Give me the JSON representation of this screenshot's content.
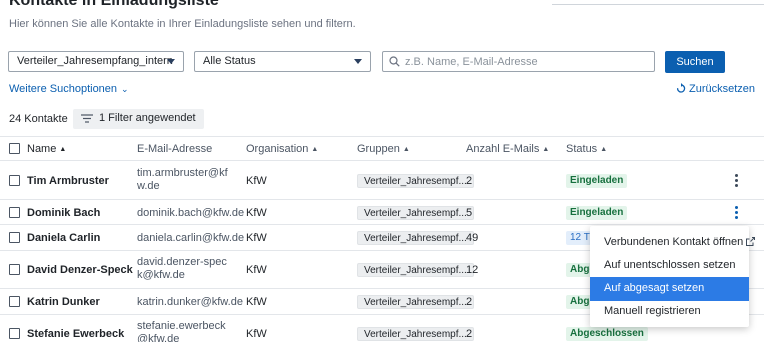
{
  "page": {
    "title": "Kontakte in Einladungsliste",
    "subtitle": "Hier können Sie alle Kontakte in Ihrer Einladungsliste sehen und filtern."
  },
  "filters": {
    "list_select": "Verteiler_Jahresempfang_intern",
    "status_select": "Alle Status",
    "search_placeholder": "z.B. Name, E-Mail-Adresse",
    "search_value": "",
    "search_button": "Suchen",
    "more_options": "Weitere Suchoptionen",
    "reset": "Zurücksetzen"
  },
  "summary": {
    "count": "24 Kontakte",
    "filter_chip": "1 Filter angewendet"
  },
  "table": {
    "headers": {
      "name": "Name",
      "email": "E-Mail-Adresse",
      "org": "Organisation",
      "groups": "Gruppen",
      "mails": "Anzahl E-Mails",
      "status": "Status"
    },
    "rows": [
      {
        "name": "Tim Armbruster",
        "email": "tim.armbruster@kfw.de",
        "org": "KfW",
        "group": "Verteiler_Jahresempf...",
        "mails": "2",
        "status": "Eingeladen"
      },
      {
        "name": "Dominik Bach",
        "email": "dominik.bach@kfw.de",
        "org": "KfW",
        "group": "Verteiler_Jahresempf...",
        "mails": "5",
        "status": "Eingeladen"
      },
      {
        "name": "Daniela Carlin",
        "email": "daniela.carlin@kfw.de",
        "org": "KfW",
        "group": "Verteiler_Jahresempf...",
        "mails": "49",
        "status": "12 T"
      },
      {
        "name": "David Denzer-Speck",
        "email": "david.denzer-speck@kfw.de",
        "org": "KfW",
        "group": "Verteiler_Jahresempf...",
        "mails": "12",
        "status": "Abge"
      },
      {
        "name": "Katrin Dunker",
        "email": "katrin.dunker@kfw.de",
        "org": "KfW",
        "group": "Verteiler_Jahresempf...",
        "mails": "2",
        "status": "Abge"
      },
      {
        "name": "Stefanie Ewerbeck",
        "email": "stefanie.ewerbeck@kfw.de",
        "org": "KfW",
        "group": "Verteiler_Jahresempf...",
        "mails": "2",
        "status": "Abgeschlossen"
      }
    ]
  },
  "context_menu": {
    "items": [
      "Verbundenen Kontakt öffnen",
      "Auf unentschlossen setzen",
      "Auf abgesagt setzen",
      "Manuell registrieren"
    ],
    "selected_index": 2
  },
  "colors": {
    "primary": "#0b5fb0",
    "status_green": "#17703e",
    "menu_highlight": "#2c7be5"
  }
}
